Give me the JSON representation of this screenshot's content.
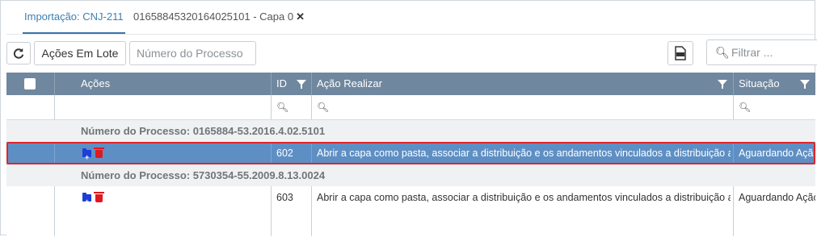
{
  "tabs": [
    {
      "label": "Importação: CNJ-211",
      "active": true
    },
    {
      "label": "01658845320164025101 - Capa 0",
      "close": "✕"
    }
  ],
  "toolbar": {
    "refresh_icon": "refresh-icon",
    "batch_actions_label": "Ações Em Lote",
    "process_number_placeholder": "Número do Processo",
    "sort_icon": "↑",
    "export_icon": "xlsx-export-icon",
    "filter_placeholder": "Filtrar ..."
  },
  "table": {
    "headers": {
      "actions": "Ações",
      "id": "ID",
      "action_to_perform": "Ação Realizar",
      "status": "Situação"
    },
    "groups": [
      {
        "label": "Número do Processo: 0165884-53.2016.4.02.5101",
        "rows": [
          {
            "id": "602",
            "action": "Abrir a capa como pasta, associar a distribuição e os andamentos vinculados a distribuição associado",
            "status": "Aguardando Ação",
            "selected": true
          }
        ]
      },
      {
        "label": "Número do Processo: 5730354-55.2009.8.13.0024",
        "rows": [
          {
            "id": "603",
            "action": "Abrir a capa como pasta, associar a distribuição e os andamentos vinculados a distribuição associado",
            "status": "Aguardando Ação",
            "selected": false
          }
        ]
      }
    ]
  },
  "colors": {
    "header_bg": "#6f879f",
    "selected_row_bg": "#5e8fc4",
    "selection_outline": "#e0242a",
    "active_tab": "#3f7fb0"
  }
}
